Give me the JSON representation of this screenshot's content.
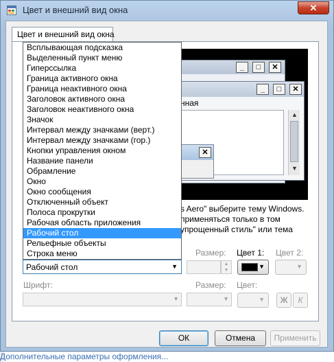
{
  "window": {
    "title": "Цвет и внешний вид окна",
    "close_label": "✕"
  },
  "background_link": "Дополнительные параметры оформления...",
  "tab": {
    "label": "Цвет и внешний вид окна"
  },
  "preview": {
    "menu_text": "нная",
    "window_buttons": [
      "_",
      "□",
      "✕"
    ],
    "message_close": "✕"
  },
  "description": "s Aero\" выберите тему Windows. применяться только в том упрощенный стиль\" или тема",
  "item": {
    "selected": "Рабочий стол",
    "options": [
      "Всплывающая подсказка",
      "Выделенный пункт меню",
      "Гиперссылка",
      "Граница активного окна",
      "Граница неактивного окна",
      "Заголовок активного окна",
      "Заголовок неактивного окна",
      "Значок",
      "Интервал между значками (верт.)",
      "Интервал между значками (гор.)",
      "Кнопки управления окном",
      "Название панели",
      "Обрамление",
      "Окно",
      "Окно сообщения",
      "Отключенный объект",
      "Полоса прокрутки",
      "Рабочая область приложения",
      "Рабочий стол",
      "Рельефные объекты",
      "Строка меню"
    ],
    "selected_index": 18
  },
  "labels": {
    "size": "Размер:",
    "color1": "Цвет 1:",
    "color2": "Цвет 2:",
    "font": "Шрифт:",
    "font_size": "Размер:",
    "font_color": "Цвет:"
  },
  "colors": {
    "color1": "#000000",
    "accent": "#3399ff"
  },
  "font_styles": {
    "bold": "Ж",
    "italic": "К"
  },
  "buttons": {
    "ok": "ОК",
    "cancel": "Отмена",
    "apply": "Применить"
  }
}
